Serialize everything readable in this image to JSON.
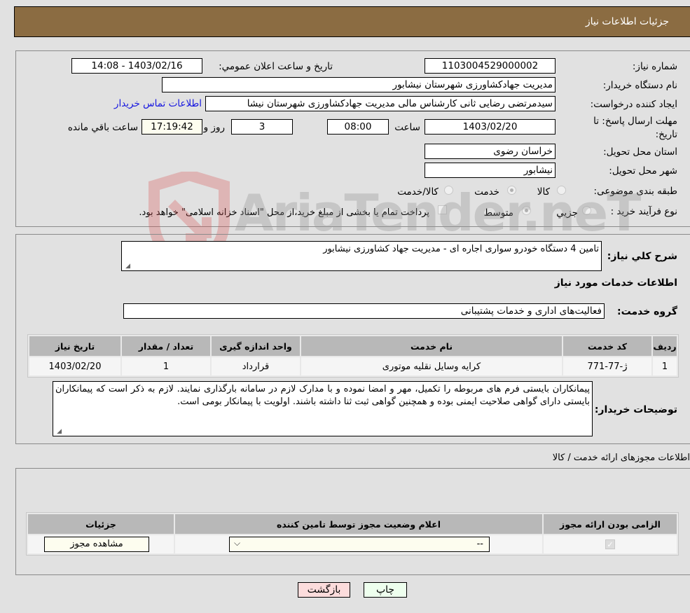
{
  "header": {
    "title": "جزئيات اطلاعات نياز"
  },
  "form": {
    "need_number": {
      "label": "شماره نياز:",
      "value": "1103004529000002"
    },
    "announce_datetime": {
      "label": "تاريخ و ساعت اعلان عمومي:",
      "value": "1403/02/16 - 14:08"
    },
    "buyer_org": {
      "label": "نام دستگاه خريدار:",
      "value": "مديريت جهادکشاورزی شهرستان نيشابور"
    },
    "requester": {
      "label": "ايجاد کننده درخواست:",
      "value": "سيدمرتضی رضايی ثانی کارشناس مالی مديريت جهادکشاورزی شهرستان نيشا",
      "contact_link": "اطلاعات تماس خريدار"
    },
    "deadline": {
      "label": "مهلت ارسال پاسخ: تا تاريخ:",
      "date": "1403/02/20",
      "time_label": "ساعت",
      "time": "08:00",
      "days": "3",
      "days_label": "روز و",
      "remaining": "17:19:42",
      "remaining_label": "ساعت باقي مانده"
    },
    "province": {
      "label": "استان محل تحويل:",
      "value": "خراسان رضوی"
    },
    "city": {
      "label": "شهر محل تحويل:",
      "value": "نيشابور"
    },
    "category": {
      "label": "طبقه بندی موضوعی:",
      "options": [
        {
          "label": "کالا",
          "selected": false
        },
        {
          "label": "خدمت",
          "selected": true
        },
        {
          "label": "کالا/خدمت",
          "selected": false
        }
      ]
    },
    "purchase_process": {
      "label": "نوع فرآيند خريد :",
      "options": [
        {
          "label": "جزيي",
          "selected": false
        },
        {
          "label": "متوسط",
          "selected": true
        }
      ],
      "treasury_checkbox_label": "پرداخت تمام يا بخشی از مبلغ خريد،از محل \"اسناد خزانه اسلامی\" خواهد بود.",
      "treasury_checked": false
    }
  },
  "description": {
    "label": "شرح کلي نياز:",
    "value": "تامين 4 دستگاه خودرو سواری اجاره ای - مديريت جهاد کشاورزی نيشابور"
  },
  "services": {
    "section_title": "اطلاعات خدمات مورد نياز",
    "group_label": "گروه خدمت:",
    "group_value": "فعاليت‌های اداری و خدمات پشتيبانی",
    "columns": [
      "رديف",
      "کد خدمت",
      "نام خدمت",
      "واحد اندازه گيری",
      "تعداد / مقدار",
      "تاريخ نياز"
    ],
    "rows": [
      [
        "1",
        "ژ-77-771",
        "کرايه وسايل نقليه موتوری",
        "قرارداد",
        "1",
        "1403/02/20"
      ]
    ]
  },
  "buyer_notes": {
    "label": "توضيحات خريدار:",
    "value": "پيمانکاران بايستی فرم های مربوطه را تکميل، مهر و امضا نموده و با مدارک لازم در سامانه بارگذاری نمايند.  لازم به ذکر است که پيمانکاران بايستی دارای گواهی صلاحيت ايمنی بوده و همچنين گواهی ثبت ثنا داشته باشند.  اولويت با پيمانکار بومی است."
  },
  "permits": {
    "section_title": "اطلاعات مجوزهای ارائه خدمت / کالا",
    "columns": [
      "الزامی بودن ارائه مجوز",
      "اعلام وضعيت مجوز توسط تامين کننده",
      "جزئيات"
    ],
    "rows": [
      {
        "required_checked": true,
        "status_value": "--",
        "details_button": "مشاهده مجوز"
      }
    ]
  },
  "actions": {
    "print": "چاپ",
    "back": "بازگشت"
  },
  "watermark": {
    "text": "AriaTender.neT"
  },
  "colors": {
    "header_bg": "#8b6c42",
    "link": "#1515e0",
    "back_btn": "#fcdcdc",
    "print_btn": "#eeffee"
  }
}
